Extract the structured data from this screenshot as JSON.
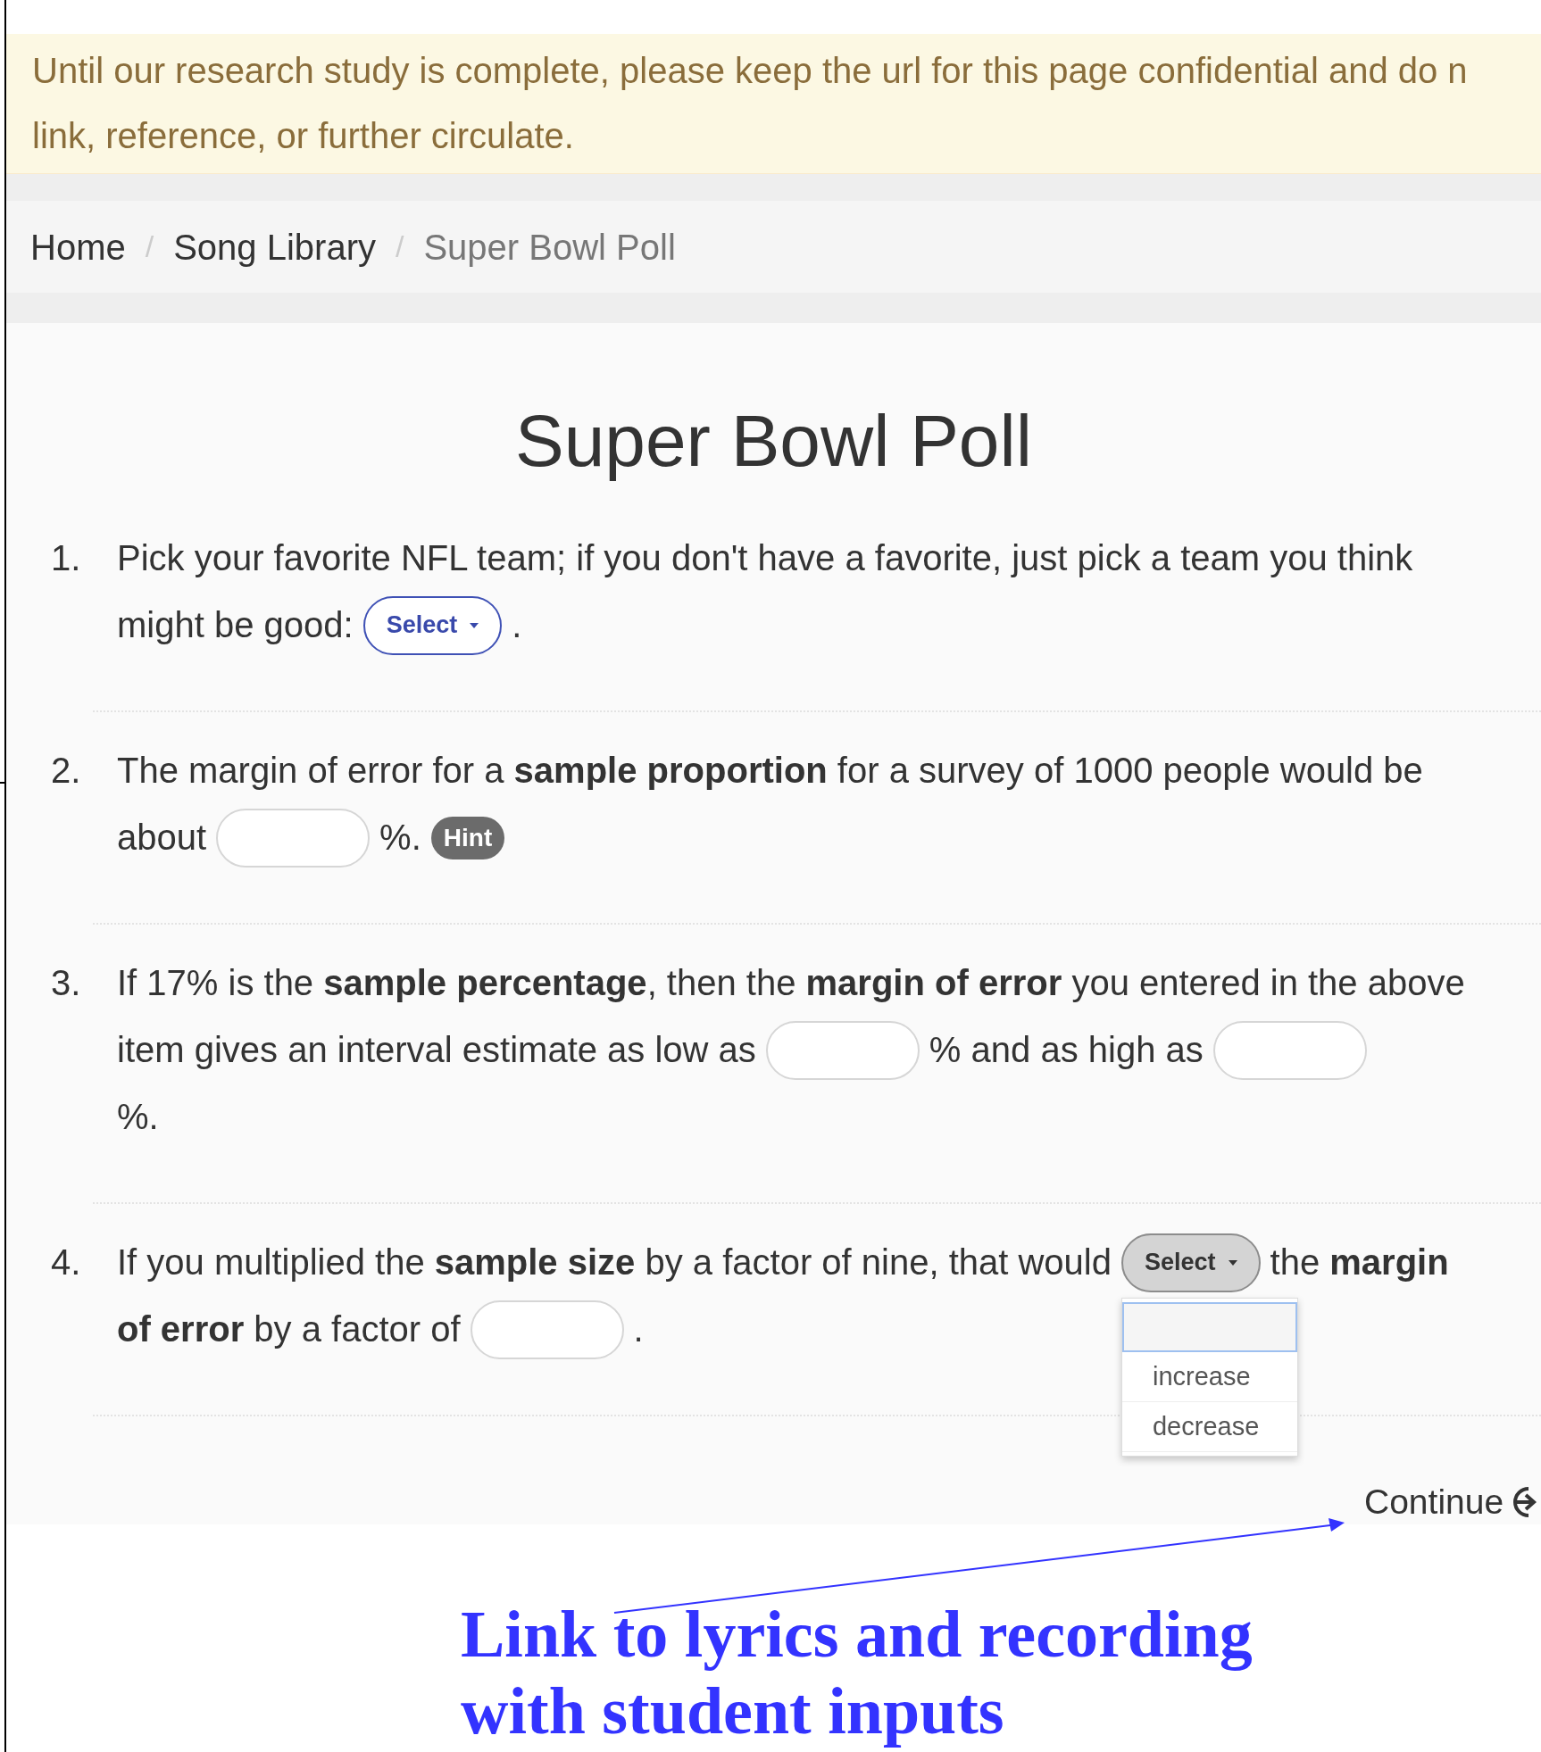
{
  "notice": {
    "lines": [
      "Until our research study is complete, please keep the url for this page confidential and do n",
      "link, reference, or further circulate."
    ]
  },
  "breadcrumb": [
    {
      "label": "Home",
      "current": false
    },
    {
      "label": "Song Library",
      "current": false
    },
    {
      "label": "Super Bowl Poll",
      "current": true
    }
  ],
  "breadcrumb_separator": "/",
  "title": "Super Bowl Poll",
  "questions": [
    {
      "number": "1.",
      "lines": [
        [
          {
            "kind": "text",
            "text": "Pick your favorite NFL team; if you don't have a favorite, just pick a team you think"
          }
        ],
        [
          {
            "kind": "text",
            "text": "might be good:"
          },
          {
            "kind": "select",
            "label": "Select",
            "focused": true,
            "open": false
          },
          {
            "kind": "text",
            "text": "."
          }
        ]
      ]
    },
    {
      "number": "2.",
      "lines": [
        [
          {
            "kind": "text",
            "text": "The margin of error for a **sample proportion** for a survey of 1000 people would be"
          }
        ],
        [
          {
            "kind": "text",
            "text": "about"
          },
          {
            "kind": "input"
          },
          {
            "kind": "text",
            "text": "%."
          },
          {
            "kind": "hint",
            "label": "Hint"
          }
        ]
      ]
    },
    {
      "number": "3.",
      "lines": [
        [
          {
            "kind": "text",
            "text": "If 17% is the **sample percentage**, then the **margin of error** you entered in the above"
          }
        ],
        [
          {
            "kind": "text",
            "text": "item gives an interval estimate as low as"
          },
          {
            "kind": "input"
          },
          {
            "kind": "text",
            "text": "% and as high as"
          },
          {
            "kind": "input"
          }
        ],
        [
          {
            "kind": "text",
            "text": "%."
          }
        ]
      ]
    },
    {
      "number": "4.",
      "lines": [
        [
          {
            "kind": "text",
            "text": "If you multiplied the **sample size** by a factor of nine, that would"
          },
          {
            "kind": "select",
            "label": "Select",
            "focused": false,
            "open": true,
            "blank_option_selected": true,
            "options": [
              {
                "label": "increase",
                "selected": false
              },
              {
                "label": "decrease",
                "selected": false
              }
            ]
          },
          {
            "kind": "text",
            "text": "the **margin**"
          }
        ],
        [
          {
            "kind": "text",
            "text": "**of error** by a factor of"
          },
          {
            "kind": "input"
          },
          {
            "kind": "text",
            "text": "."
          }
        ]
      ]
    }
  ],
  "continue_link": {
    "label": "Continue"
  },
  "annotation": {
    "text": "Link to lyrics and recording with student inputs"
  }
}
